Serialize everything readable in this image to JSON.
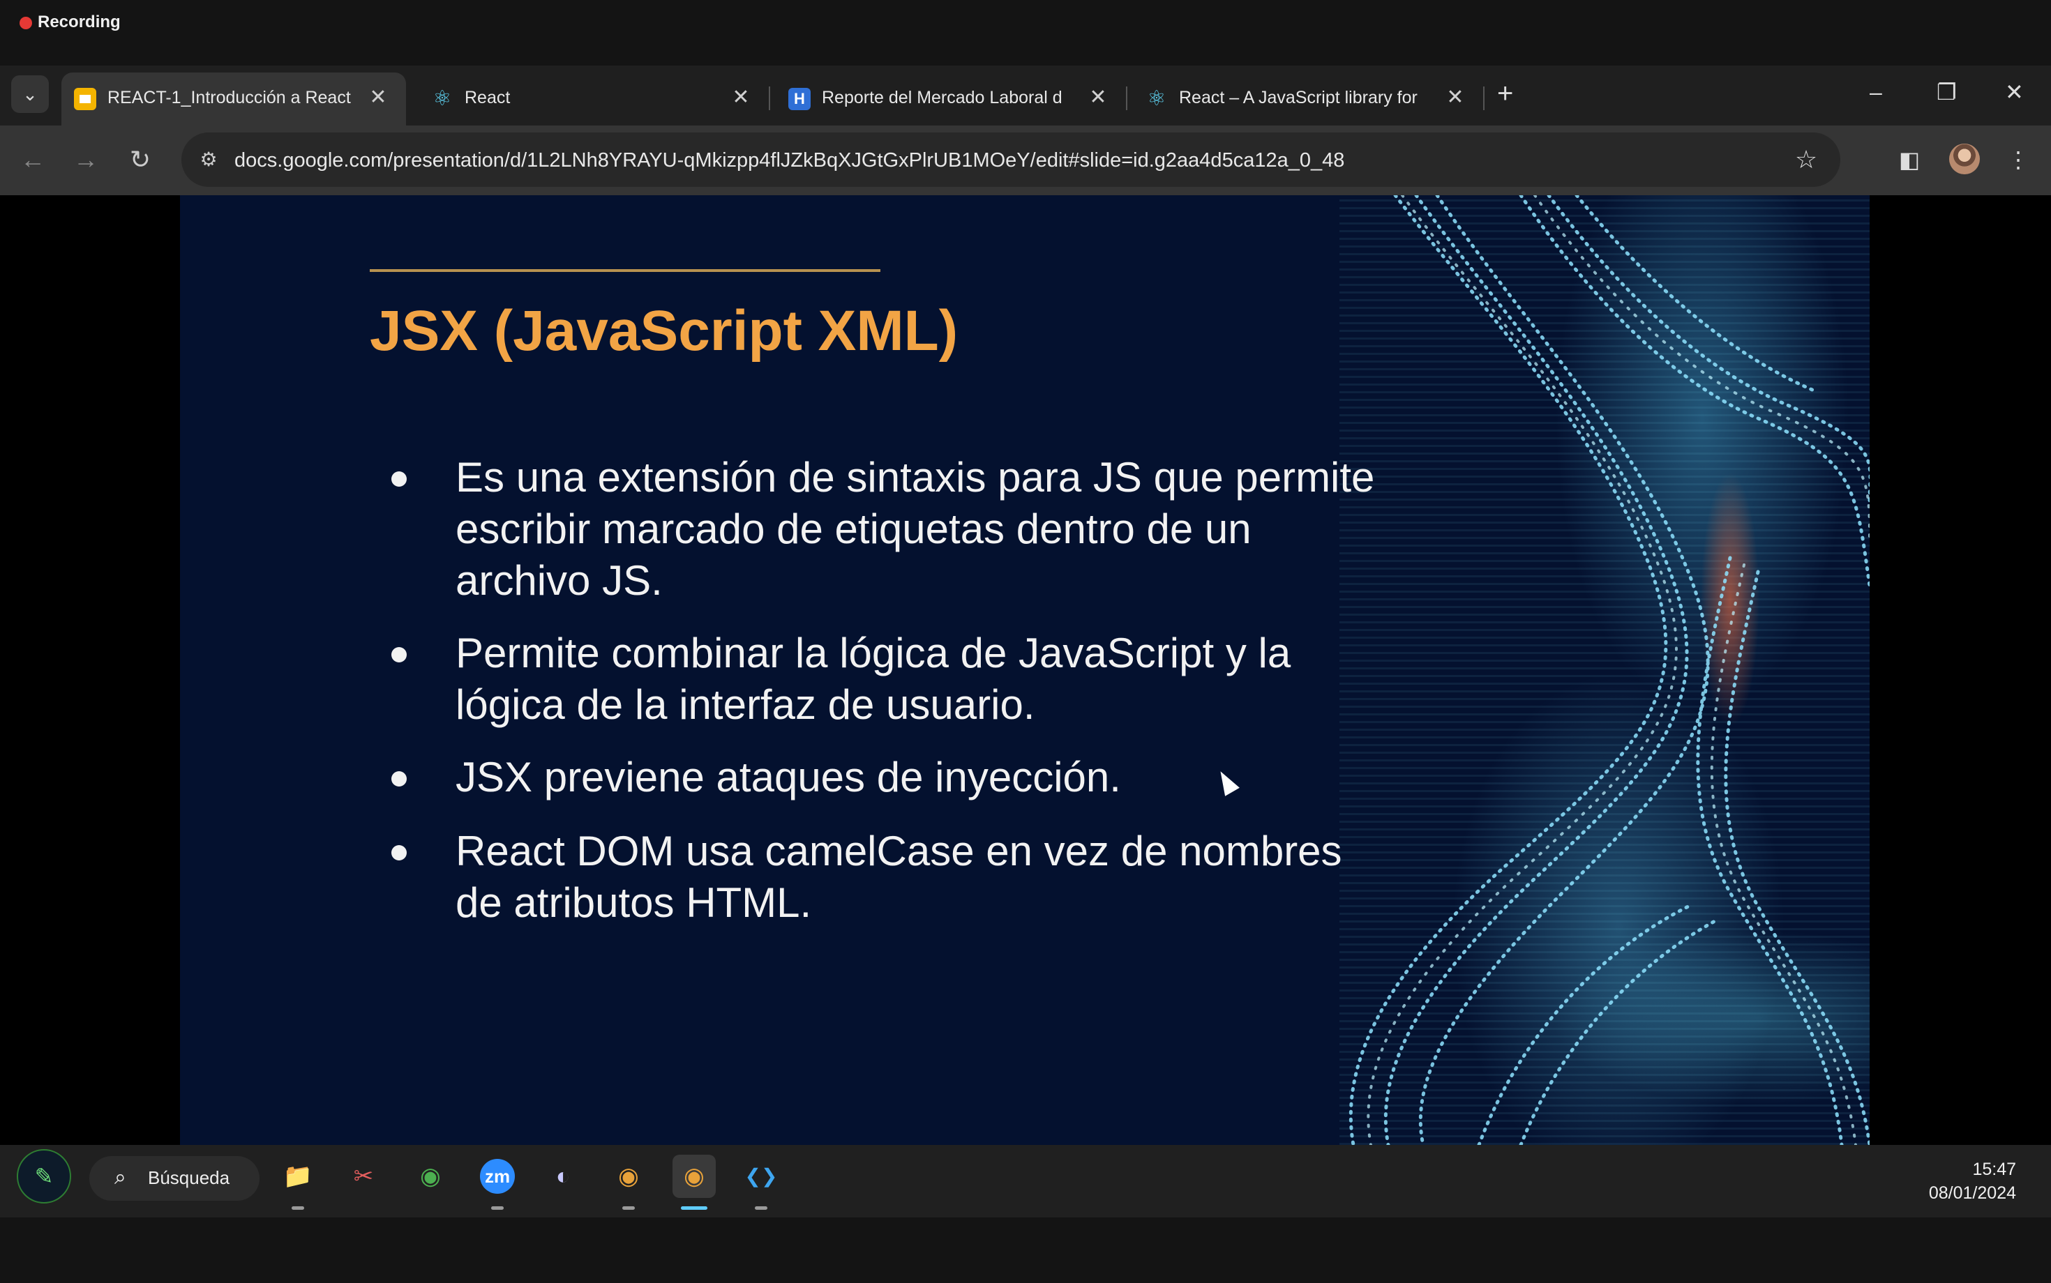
{
  "recording": {
    "label": "Recording"
  },
  "browser": {
    "tabs": [
      {
        "title": "REACT-1_Introducción a React -",
        "favicon": "slides-icon",
        "active": true
      },
      {
        "title": "React",
        "favicon": "react-icon",
        "active": false
      },
      {
        "title": "Reporte del Mercado Laboral d",
        "favicon": "h-icon",
        "active": false
      },
      {
        "title": "React – A JavaScript library for",
        "favicon": "react-icon",
        "active": false
      }
    ],
    "close_glyph": "✕",
    "new_tab_glyph": "+",
    "tab_search_glyph": "⌄",
    "window_controls": {
      "minimize": "–",
      "restore": "❐",
      "close": "✕"
    },
    "nav": {
      "back": "←",
      "forward": "→",
      "reload": "↻"
    },
    "url": "docs.google.com/presentation/d/1L2LNh8YRAYU-qMkizpp4flJZkBqXJGtGxPlrUB1MOeY/edit#slide=id.g2aa4d5ca12a_0_48",
    "site_info_glyph": "⚙",
    "star_glyph": "☆",
    "side_panel_glyph": "◧",
    "menu_glyph": "⋮"
  },
  "slide": {
    "title": "JSX (JavaScript XML)",
    "bullets": [
      "Es una extensión de sintaxis para JS que permite escribir marcado de etiquetas dentro de un archivo JS.",
      "Permite combinar la lógica de JavaScript y la lógica de la interfaz de usuario.",
      "JSX previene ataques de inyección.",
      "React DOM usa camelCase en vez de nombres de atributos HTML."
    ],
    "colors": {
      "background": "#04112f",
      "title": "#f2a445",
      "rule": "#b79250",
      "text": "#f2f2f2"
    }
  },
  "taskbar": {
    "search_label": "Búsqueda",
    "search_glyph": "⌕",
    "widgets_glyph": "✎",
    "apps": [
      {
        "name": "file-explorer-icon",
        "glyph": "📁",
        "running": true
      },
      {
        "name": "snipping-tool-icon",
        "glyph": "✂",
        "running": false
      },
      {
        "name": "chrome-icon",
        "glyph": "◉",
        "running": false
      },
      {
        "name": "zoom-icon",
        "glyph": "zm",
        "running": true
      },
      {
        "name": "eclipse-icon",
        "glyph": "◐",
        "running": false
      },
      {
        "name": "chrome-profile-icon",
        "glyph": "◉",
        "running": true
      },
      {
        "name": "chrome-active-icon",
        "glyph": "◉",
        "running": true,
        "active": true
      },
      {
        "name": "vscode-icon",
        "glyph": "❮❯",
        "running": true
      }
    ],
    "time": "15:47",
    "date": "08/01/2024"
  }
}
